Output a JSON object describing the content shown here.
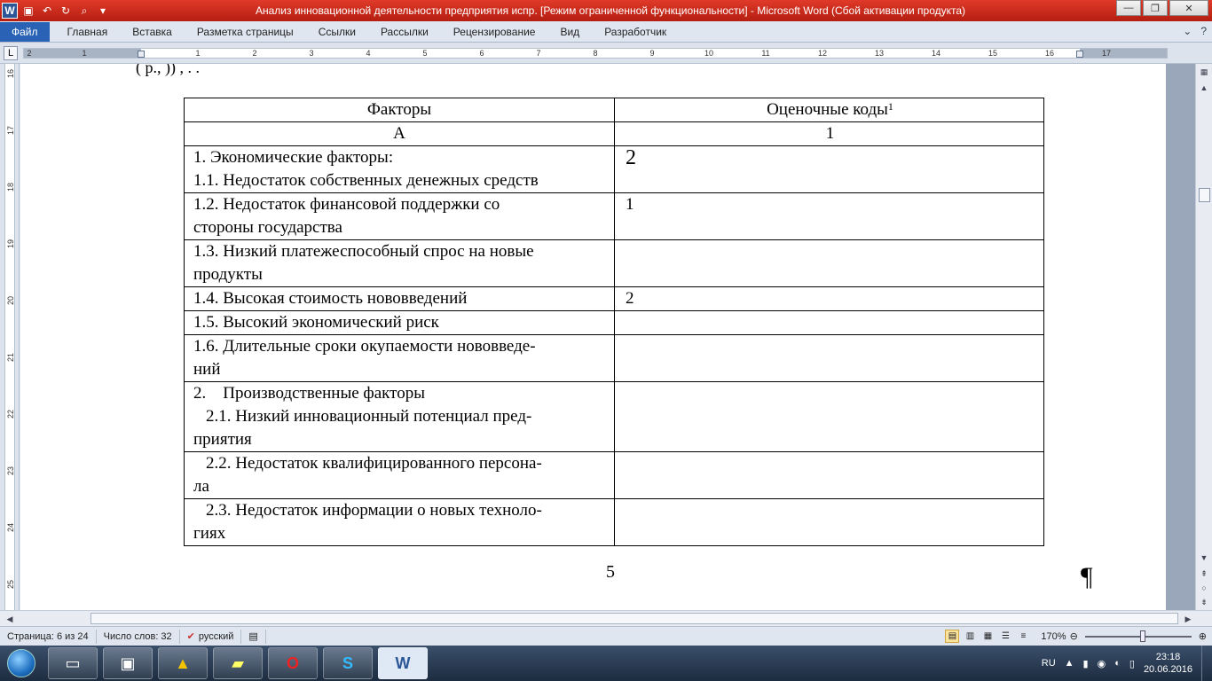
{
  "window": {
    "title": "Анализ инновационной деятельности предприятия испр. [Режим ограниченной функциональности]  -  Microsoft Word (Сбой активации продукта)",
    "app_logo": "W",
    "controls": {
      "minimize": "—",
      "maximize": "❐",
      "close": "✕"
    }
  },
  "ribbon": {
    "file_tab": "Файл",
    "tabs": [
      "Главная",
      "Вставка",
      "Разметка страницы",
      "Ссылки",
      "Рассылки",
      "Рецензирование",
      "Вид",
      "Разработчик"
    ],
    "help": "?"
  },
  "ruler": {
    "tab_selector": "L",
    "numbers": [
      "2",
      "1",
      "1",
      "1",
      "2",
      "3",
      "4",
      "5",
      "6",
      "7",
      "8",
      "9",
      "10",
      "11",
      "12",
      "13",
      "14",
      "15",
      "16",
      "17"
    ],
    "vertical_numbers": [
      "16",
      "17",
      "18",
      "19",
      "20",
      "21",
      "22",
      "23",
      "24",
      "25"
    ]
  },
  "document": {
    "top_partial_text": "(                                                         р., ))                        ,  .          .",
    "table": {
      "header": {
        "col1": "Факторы",
        "col2": "Оценочные коды",
        "col2_sup": "1"
      },
      "subheader": {
        "col1": "А",
        "col2": "1"
      },
      "rows": [
        {
          "lines": [
            "1. Экономические факторы:",
            "1.1. Недостаток собственных денежных средств"
          ],
          "code": "2"
        },
        {
          "lines": [
            "1.2. Недостаток финансовой поддержки со",
            "стороны государства"
          ],
          "code": "1"
        },
        {
          "lines": [
            "1.3. Низкий платежеспособный спрос на новые",
            "продукты"
          ],
          "code": ""
        },
        {
          "lines": [
            "1.4. Высокая стоимость нововведений"
          ],
          "code": "2"
        },
        {
          "lines": [
            "1.5. Высокий экономический риск"
          ],
          "code": ""
        },
        {
          "lines": [
            "1.6. Длительные сроки окупаемости нововведе-",
            "ний"
          ],
          "code": ""
        },
        {
          "lines": [
            "2.    Производственные факторы",
            "2.1. Низкий инновационный потенциал пред-",
            "приятия"
          ],
          "code": ""
        },
        {
          "lines": [
            "2.2. Недостаток квалифицированного персона-",
            "ла"
          ],
          "code": ""
        },
        {
          "lines": [
            "2.3. Недостаток информации о новых техноло-",
            "гиях"
          ],
          "code": ""
        }
      ]
    },
    "page_number": "5",
    "pilcrow": "¶"
  },
  "statusbar": {
    "page": "Страница: 6 из 24",
    "words": "Число слов: 32",
    "language": "русский",
    "zoom": "170%",
    "zoom_level_percent": 170
  },
  "taskbar": {
    "language": "RU",
    "time": "23:18",
    "date": "20.06.2016"
  },
  "colors": {
    "titlebar": "#c62a1c",
    "file_tab": "#2a63b5",
    "taskbar": "#2a3b52"
  }
}
